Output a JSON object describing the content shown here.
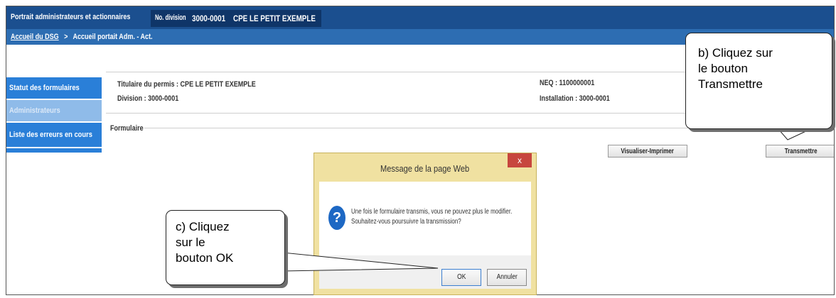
{
  "header": {
    "app_title": "Portrait administrateurs et actionnaires",
    "division_prefix": "No. division",
    "division_no": "3000-0001",
    "division_name": "CPE LE PETIT EXEMPLE"
  },
  "breadcrumb": {
    "home_link": "Accueil du DSG",
    "separator": ">",
    "current": "Accueil portait Adm. - Act."
  },
  "sidebar": {
    "items": [
      {
        "label": "Statut des formulaires",
        "enabled": true
      },
      {
        "label": "Administrateurs",
        "enabled": false
      },
      {
        "label": "Liste des erreurs en cours",
        "enabled": true
      }
    ]
  },
  "info": {
    "permit_holder": "Titulaire du permis : CPE LE PETIT EXEMPLE",
    "division": "Division : 3000-0001",
    "neq": "NEQ : 1100000001",
    "installation": "Installation : 3000-0001"
  },
  "form": {
    "section_label": "Formulaire",
    "view_print_button": "Visualiser-Imprimer",
    "transmit_button": "Transmettre"
  },
  "dialog": {
    "title": "Message de la page Web",
    "close_label": "x",
    "icon": "question-icon",
    "message_line1": "Une fois le formulaire transmis, vous ne pouvez plus le modifier.",
    "message_line2": "Souhaitez-vous poursuivre la transmission?",
    "ok_button": "OK",
    "cancel_button": "Annuler"
  },
  "callouts": {
    "b": "b) Cliquez sur\nle bouton\nTransmettre",
    "c": "c) Cliquez\nsur le\nbouton OK"
  },
  "colors": {
    "header_dark": "#1b4f8f",
    "header_tab": "#0f3568",
    "breadcrumb_bar": "#2d6db2",
    "sidebar_blue": "#2a7fd8",
    "dialog_frame": "#f0e1a1",
    "dialog_close": "#c7463e"
  }
}
